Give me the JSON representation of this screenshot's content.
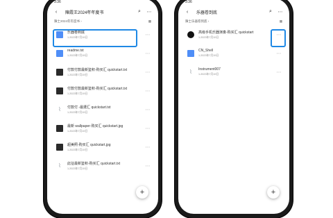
{
  "left": {
    "status": "3:36",
    "title": "陳霞王2024年年度书",
    "crumb": "陳士2024年年度书 ›",
    "files": [
      {
        "icon": "folder",
        "name": "乐器卷到底",
        "meta": "1.2023年7月19日"
      },
      {
        "icon": "doc",
        "name": "readme.txt",
        "meta": "1.2023年7月19日"
      },
      {
        "icon": "dark",
        "name": "付款付款最新鉴积-购买汇 quickstart.txt",
        "meta": "1.2023年7月19日"
      },
      {
        "icon": "dark",
        "name": "付款付款最新鉴积-购买汇 quickstart.txt",
        "meta": "1.2023年7月19日"
      },
      {
        "icon": "clip",
        "name": "付款付 -最遭汇 quickstart.txt",
        "meta": "1.2023年7月19日"
      },
      {
        "icon": "dark",
        "name": "最新 wallpaper-购买汇 quickstart.jpg",
        "meta": "1.2023年7月19日"
      },
      {
        "icon": "dark",
        "name": "超美照-购买汇 quickstart.jpg",
        "meta": "1.2023年7月19日"
      },
      {
        "icon": "clip",
        "name": "此征最新鉴积-购买汇 quickstart.txt",
        "meta": "1.2023年7月19日"
      }
    ]
  },
  "right": {
    "status": "3:36",
    "title": "乐器卷到底",
    "crumb": "陳士乐器卷到底 ›",
    "files": [
      {
        "icon": "black-app",
        "name": "高级手机乐器演奏-购买汇 quickstart",
        "meta": "1.2023年7月19日"
      },
      {
        "icon": "doc",
        "name": "CN_Shell",
        "meta": "1.2023年7月19日"
      },
      {
        "icon": "clip",
        "name": "Instrument007",
        "meta": "1.2023年7月19日"
      }
    ]
  },
  "icons": {
    "back": "back-arrow-icon",
    "search": "search-icon",
    "more": "more-icon",
    "add": "plus-icon"
  },
  "accent": "#1e88e5"
}
